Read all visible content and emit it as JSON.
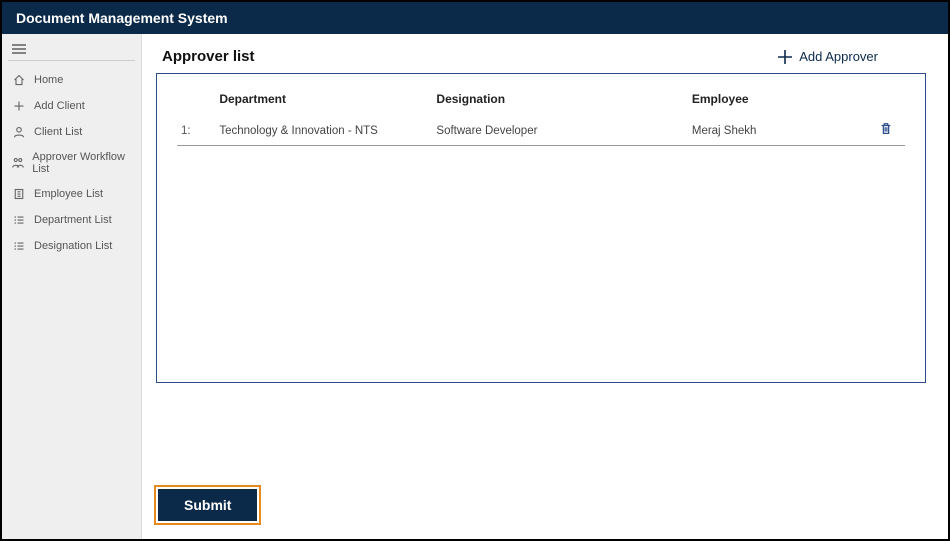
{
  "app_title": "Document Management System",
  "sidebar": {
    "items": [
      {
        "icon": "home-icon",
        "label": "Home"
      },
      {
        "icon": "plus-icon",
        "label": "Add Client"
      },
      {
        "icon": "user-icon",
        "label": "Client List"
      },
      {
        "icon": "workflow-icon",
        "label": "Approver Workflow List"
      },
      {
        "icon": "employee-icon",
        "label": "Employee List"
      },
      {
        "icon": "list-icon",
        "label": "Department List"
      },
      {
        "icon": "list-icon",
        "label": "Designation List"
      }
    ]
  },
  "main": {
    "title": "Approver list",
    "add_label": "Add Approver",
    "headers": {
      "index": "",
      "department": "Department",
      "designation": "Designation",
      "employee": "Employee"
    },
    "rows": [
      {
        "index": "1:",
        "department": "Technology & Innovation - NTS",
        "designation": "Software Developer",
        "employee": "Meraj Shekh"
      }
    ],
    "submit_label": "Submit"
  }
}
